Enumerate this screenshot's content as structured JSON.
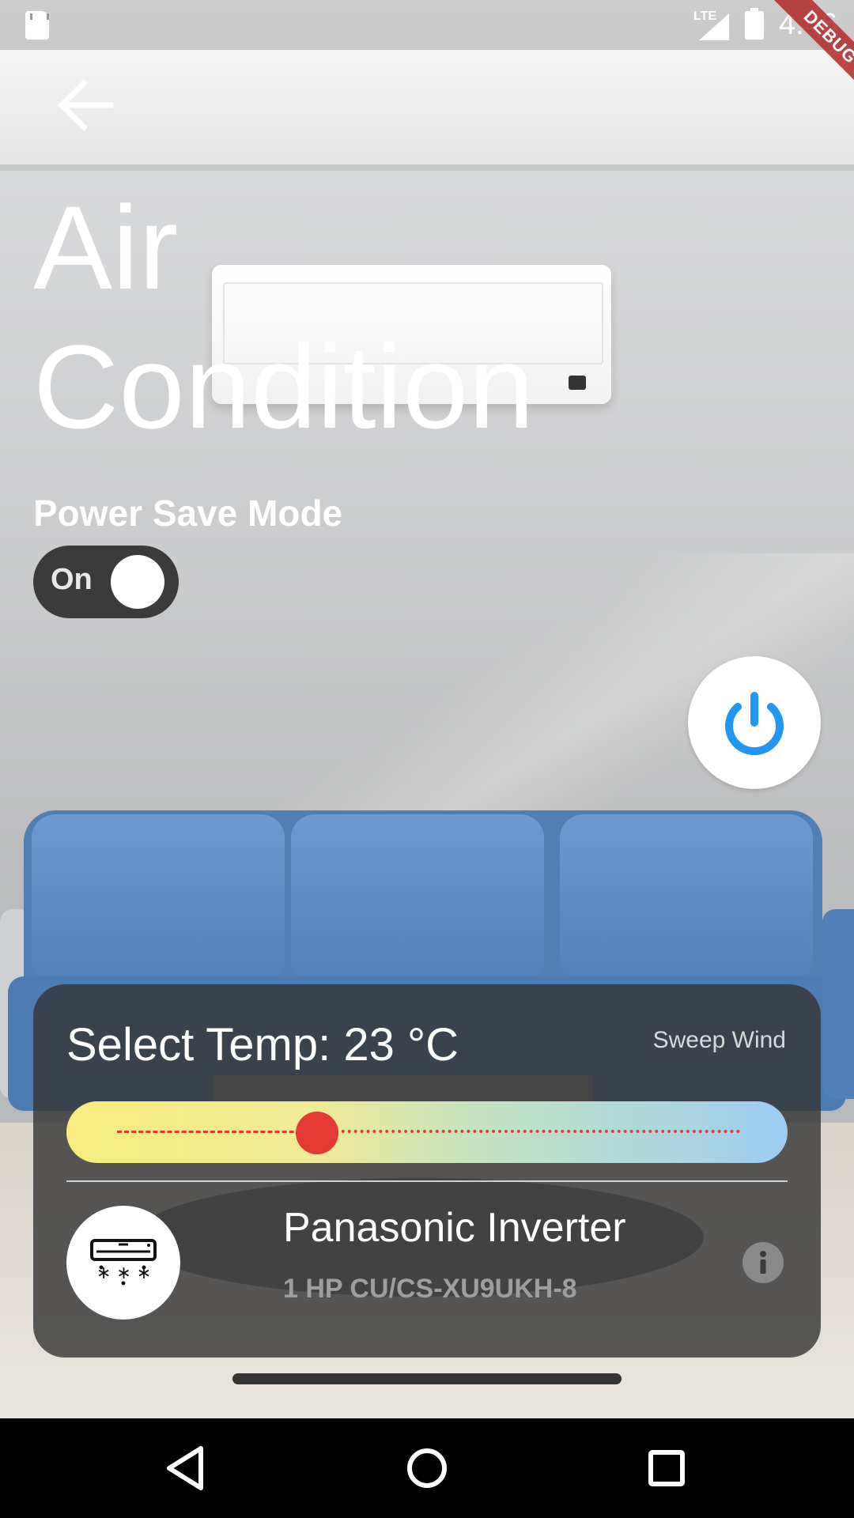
{
  "status_bar": {
    "network": "LTE",
    "time": "4:46",
    "debug_banner": "DEBUG"
  },
  "header": {
    "title": "Air Condition"
  },
  "power_save": {
    "label": "Power Save Mode",
    "toggle_text": "On",
    "enabled": true
  },
  "control_panel": {
    "temp_label": "Select Temp: 23 °C",
    "temperature_c": 23,
    "sweep_label": "Sweep Wind",
    "device_name": "Panasonic Inverter",
    "device_model": "1 HP CU/CS-XU9UKH-8"
  },
  "colors": {
    "accent_blue": "#2196f3",
    "slider_thumb": "#e53935",
    "panel_bg": "#373737"
  },
  "icons": {
    "back": "arrow-left-icon",
    "power": "power-icon",
    "device": "air-conditioner-icon",
    "info": "info-icon",
    "nav_back": "triangle-back-icon",
    "nav_home": "circle-home-icon",
    "nav_recents": "square-recents-icon"
  }
}
